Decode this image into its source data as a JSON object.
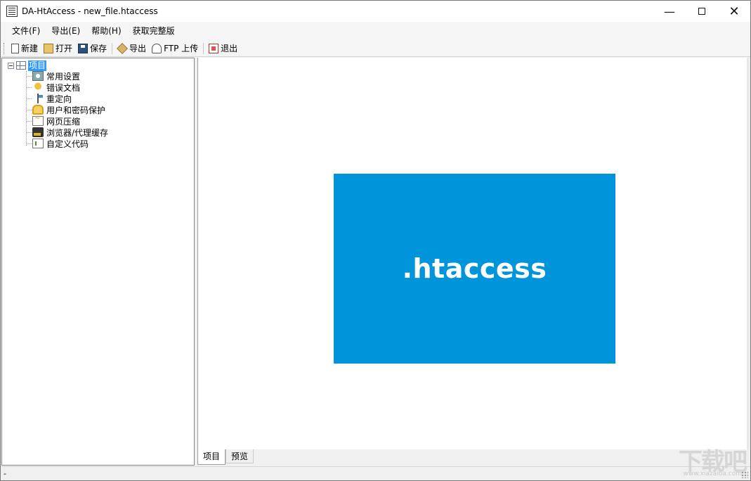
{
  "window": {
    "title": "DA-HtAccess - new_file.htaccess",
    "controls": {
      "minimize": "—",
      "close": "✕"
    }
  },
  "menu": [
    "文件(F)",
    "导出(E)",
    "帮助(H)",
    "获取完整版"
  ],
  "toolbar": {
    "new_label": "新建",
    "open_label": "打开",
    "save_label": "保存",
    "export_label": "导出",
    "ftp_label": "FTP 上传",
    "exit_label": "退出"
  },
  "tree": {
    "root": "项目",
    "items": [
      {
        "label": "常用设置",
        "icon": "settings-icon"
      },
      {
        "label": "错误文档",
        "icon": "error-icon"
      },
      {
        "label": "重定向",
        "icon": "redirect-icon"
      },
      {
        "label": "用户和密码保护",
        "icon": "lock-icon"
      },
      {
        "label": "网页压缩",
        "icon": "compress-icon"
      },
      {
        "label": "浏览器/代理缓存",
        "icon": "cache-icon"
      },
      {
        "label": "自定义代码",
        "icon": "code-icon"
      }
    ]
  },
  "content": {
    "banner_text": ".htaccess",
    "banner_color": "#0095db"
  },
  "tabs": [
    "项目",
    "预览"
  ],
  "status": {
    "text": "-"
  },
  "watermark": {
    "main": "下载吧",
    "sub": "www.xiazaiba.com"
  }
}
